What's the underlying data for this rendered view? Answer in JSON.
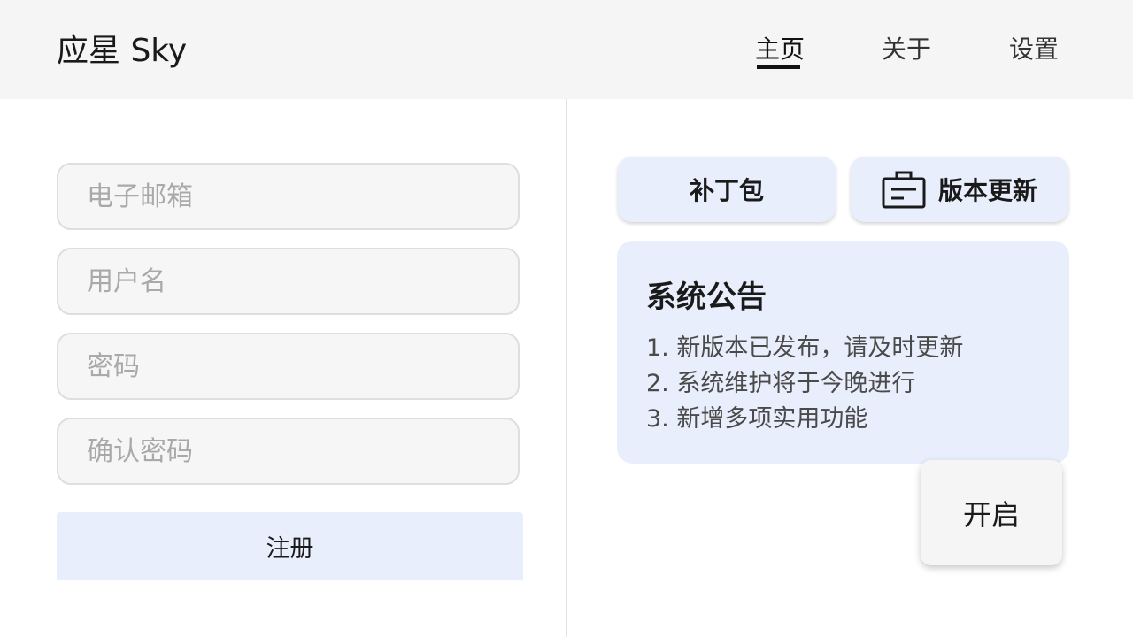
{
  "header": {
    "brand": "应星 Sky",
    "nav": [
      {
        "label": "主页",
        "active": true
      },
      {
        "label": "关于",
        "active": false
      },
      {
        "label": "设置",
        "active": false
      }
    ]
  },
  "form": {
    "fields": [
      {
        "placeholder": "电子邮箱",
        "value": ""
      },
      {
        "placeholder": "用户名",
        "value": ""
      },
      {
        "placeholder": "密码",
        "value": ""
      },
      {
        "placeholder": "确认密码",
        "value": ""
      }
    ],
    "submit_label": "注册"
  },
  "right": {
    "buttons": [
      {
        "label": "补丁包",
        "icon": null
      },
      {
        "label": "版本更新",
        "icon": "notice-board-icon"
      }
    ],
    "notice": {
      "title": "系统公告",
      "items": [
        "1. 新版本已发布，请及时更新",
        "2. 系统维护将于今晚进行",
        "3. 新增多项实用功能"
      ]
    },
    "float_button_label": "开启"
  },
  "colors": {
    "header_bg": "#f5f5f5",
    "accent_bg": "#e8eefb",
    "field_bg": "#f6f6f6",
    "placeholder": "#a9a9a9"
  }
}
